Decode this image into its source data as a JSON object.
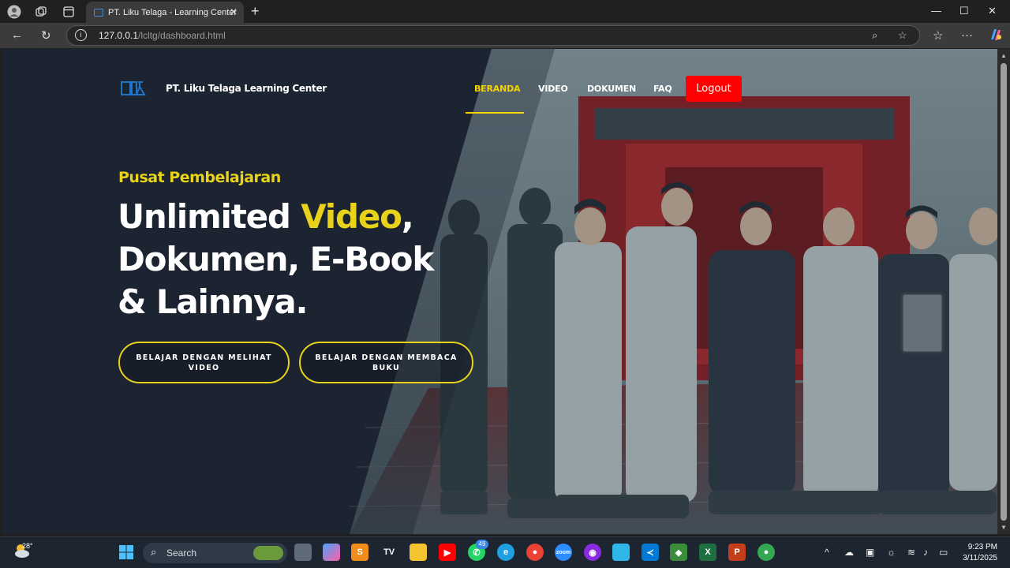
{
  "browser": {
    "tab_title": "PT. Liku Telaga - Learning Center",
    "url_host": "127.0.0.1",
    "url_path": "/lcltg/dashboard.html"
  },
  "site": {
    "brand": "PT. Liku Telaga Learning Center",
    "nav": [
      {
        "label": "BERANDA",
        "active": true
      },
      {
        "label": "VIDEO",
        "active": false
      },
      {
        "label": "DOKUMEN",
        "active": false
      },
      {
        "label": "FAQ",
        "active": false
      }
    ],
    "logout_label": "Logout",
    "accent_color": "#f3d400",
    "logout_color": "#ff0000"
  },
  "hero": {
    "eyebrow": "Pusat Pembelajaran",
    "headline_part1": "Unlimited ",
    "headline_highlight": "Video",
    "headline_part2": ",",
    "headline_line2": "Dokumen, E-Book",
    "headline_line3": "& Lainnya.",
    "cta_primary": "BELAJAR DENGAN MELIHAT VIDEO",
    "cta_secondary": "BELAJAR DENGAN MEMBACA BUKU"
  },
  "taskbar": {
    "temperature": "28°",
    "search_placeholder": "Search",
    "whatsapp_badge": "49",
    "time": "9:23 PM",
    "date": "3/11/2025"
  }
}
